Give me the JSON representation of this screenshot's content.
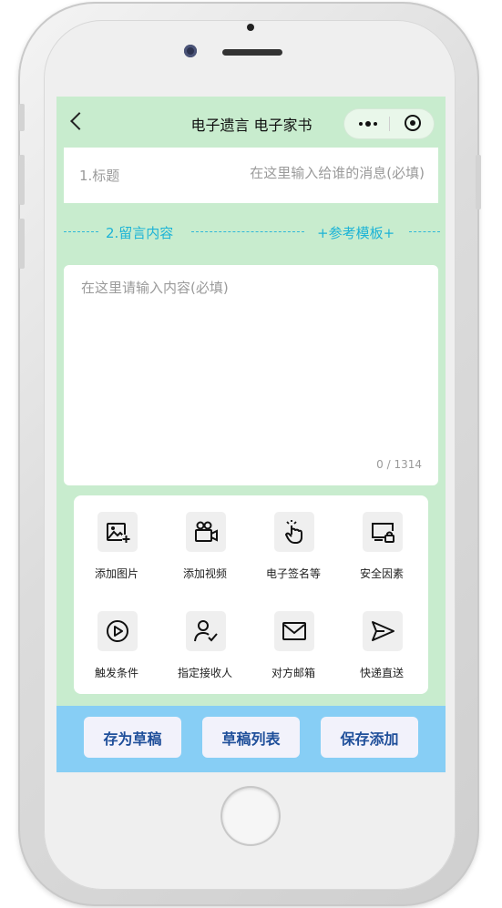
{
  "app": {
    "title": "电子遗言 电子家书"
  },
  "form": {
    "title_label": "1.标题",
    "title_placeholder": "在这里输入给谁的消息(必填)",
    "section_label": "2.留言内容",
    "template_link": "+参考模板+",
    "content_placeholder": "在这里请输入内容(必填)",
    "counter": "0 / 1314"
  },
  "tools": [
    {
      "label": "添加图片",
      "icon": "add-image-icon"
    },
    {
      "label": "添加视频",
      "icon": "video-camera-icon"
    },
    {
      "label": "电子签名等",
      "icon": "touch-hand-icon"
    },
    {
      "label": "安全因素",
      "icon": "screen-lock-icon"
    },
    {
      "label": "触发条件",
      "icon": "play-circle-icon"
    },
    {
      "label": "指定接收人",
      "icon": "user-check-icon"
    },
    {
      "label": "对方邮箱",
      "icon": "mail-icon"
    },
    {
      "label": "快递直送",
      "icon": "send-icon"
    }
  ],
  "actions": {
    "save_draft": "存为草稿",
    "draft_list": "草稿列表",
    "save_add": "保存添加"
  },
  "colors": {
    "screen_bg": "#c8ecce",
    "accent": "#1cb3d6",
    "bottom_bar": "#87cef5",
    "button_text": "#1f4f9a"
  }
}
